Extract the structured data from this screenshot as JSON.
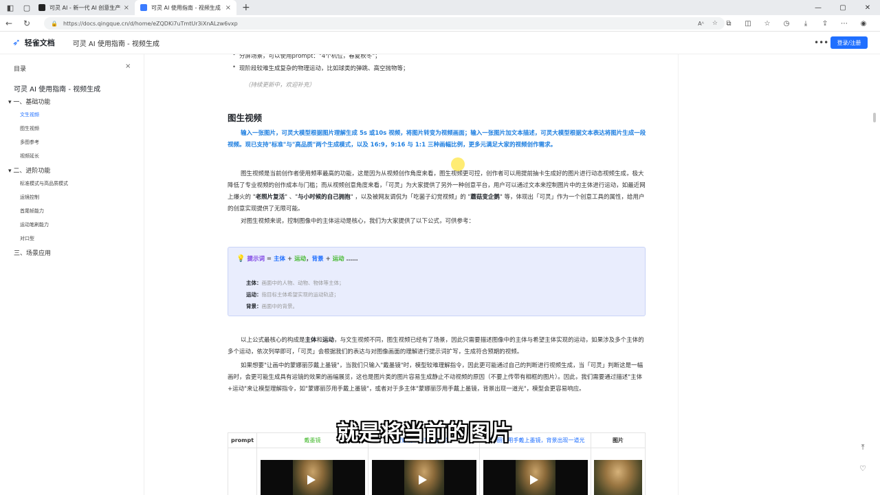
{
  "browser": {
    "tabs": [
      {
        "title": "可灵 AI - 新一代 AI 创意生产力平台",
        "active": false
      },
      {
        "title": "可灵 AI 使用指南 - 视频生成 - 轻雀文档",
        "active": true
      }
    ],
    "url": "https://docs.qingque.cn/d/home/eZQDKi7uTmtUr3iXnALzw6vxp",
    "reader_label": "Aᴬ"
  },
  "header": {
    "logo_text": "轻雀文档",
    "doc_title": "可灵 AI 使用指南 - 视频生成",
    "login_label": "登录/注册",
    "accent": "#1f6fff"
  },
  "sidebar": {
    "heading": "目录",
    "root": "可灵 AI 使用指南 - 视频生成",
    "items": [
      {
        "label": "一、基础功能",
        "level": 1,
        "toggle": "▾"
      },
      {
        "label": "文生视频",
        "level": 2,
        "active": true
      },
      {
        "label": "图生视频",
        "level": 2
      },
      {
        "label": "多图参考",
        "level": 2
      },
      {
        "label": "视频延长",
        "level": 2
      },
      {
        "label": "二、进阶功能",
        "level": 1,
        "toggle": "▾"
      },
      {
        "label": "标准模式与高品质模式",
        "level": 2
      },
      {
        "label": "运镜控制",
        "level": 2
      },
      {
        "label": "首尾帧能力",
        "level": 2
      },
      {
        "label": "运动笔刷能力",
        "level": 2
      },
      {
        "label": "对口型",
        "level": 2
      },
      {
        "label": "三、场景应用",
        "level": 1,
        "toggle": ""
      }
    ]
  },
  "content": {
    "bullets": [
      "分屏场景，可以使用prompt：\"4个机位，春夏秋冬\"；",
      "现阶段较难生成复杂的物理运动，比如球类的弹跳、高空抛物等；"
    ],
    "note": "（持续更新中，欢迎补充）",
    "section_title": "图生视频",
    "blue_para": "输入一张图片，可灵大模型根据图片理解生成 5s 或10s 视频，将图片转变为视频画面；输入一张图片加文本描述，可灵大模型根据文本表达将图片生成一段视频。现已支持\"标准\"与\"高品质\"两个生成模式，以及 16:9，9:16 与 1:1 三种画幅比例，更多元满足大家的视频创作需求。",
    "para1": {
      "a": "图生视频是当前创作者使用频率最高的功能，这是因为从视频创作角度来看，图生视频更可控，创作者可以用提前抽卡生成好的图片进行动态视频生成，极大降低了专业视频的创作成本与门槛；而从视频创意角度来看，「可灵」为大家提供了另外一种创意平台，用户可以通过文本来控制图片中的主体进行运动，如最近网上爆火的 \"",
      "b1": "老照片复活",
      "c": "\" 、\"",
      "b2": "与小时候的自己拥抱",
      "d": "\" ，以及被网友调侃为「吃菌子幻觉视频」的 \"",
      "b3": "蘑菇变企鹅",
      "e": "\" 等，体现出「可灵」作为一个创意工具的属性，给用户的创意实现提供了无限可能。"
    },
    "para2": "对图生视频来说，控制图像中的主体运动是核心，我们为大家提供了以下公式，可供参考：",
    "callout": {
      "bulb": "💡",
      "keyword": "提示词",
      "eq": " = ",
      "subject": "主体",
      "plus1": " + ",
      "motion": "运动",
      "comma": "，",
      "bg": "背景",
      "plus2": " + ",
      "motion2": "运动",
      "ellipsis": " ……",
      "rows": [
        {
          "k": "主体：",
          "v": "画面中的人物、动物、物体等主体；"
        },
        {
          "k": "运动：",
          "v": "指目标主体希望实现的运动轨迹；"
        },
        {
          "k": "背景：",
          "v": "画面中的背景。"
        }
      ]
    },
    "para3": {
      "a": "以上公式最核心的构成是",
      "b1": "主体",
      "c": "和",
      "b2": "运动",
      "d": "，与文生视频不同，图生视频已经有了场景，因此只需要描述图像中的主体与希望主体实现的运动，如果涉及多个主体的多个运动，依次列举即可，「可灵」会根据我们的表达与对图像画面的理解进行提示词扩写，生成符合预期的视频。"
    },
    "para4": "如果想要\"让画中的蒙娜丽莎戴上墨镜\"，当我们只输入\"戴墨镜\"时，模型较难理解指令，因此更可能通过自己的判断进行视频生成，当「可灵」判断这是一幅画时，会更可能生成具有运镜的效果的画幅展览，这也是图片类的图片容易生成静止不动视频的原因（不要上传带有相框的图片）。因此，我们需要通过描述\"主体+运动\"来让模型理解指令，如\"蒙娜丽莎用手戴上墨镜\"，或者对于多主体\"蒙娜丽莎用手戴上墨镜，背景出现一道光\"，模型会更容易响应。",
    "table": {
      "headers": [
        "prompt",
        "戴墨镜",
        "蒙娜丽莎用手戴上墨镜",
        "蒙娜丽莎用手戴上墨镜，背景出现一道光",
        "图片"
      ],
      "row_label": "视频"
    }
  },
  "overlay": {
    "subtitle": "就是将当前的图片"
  },
  "icons": {
    "back": "←",
    "refresh": "↻",
    "new_tab": "+",
    "more": "…",
    "close": "×",
    "top": "⤒",
    "help": "♡"
  }
}
